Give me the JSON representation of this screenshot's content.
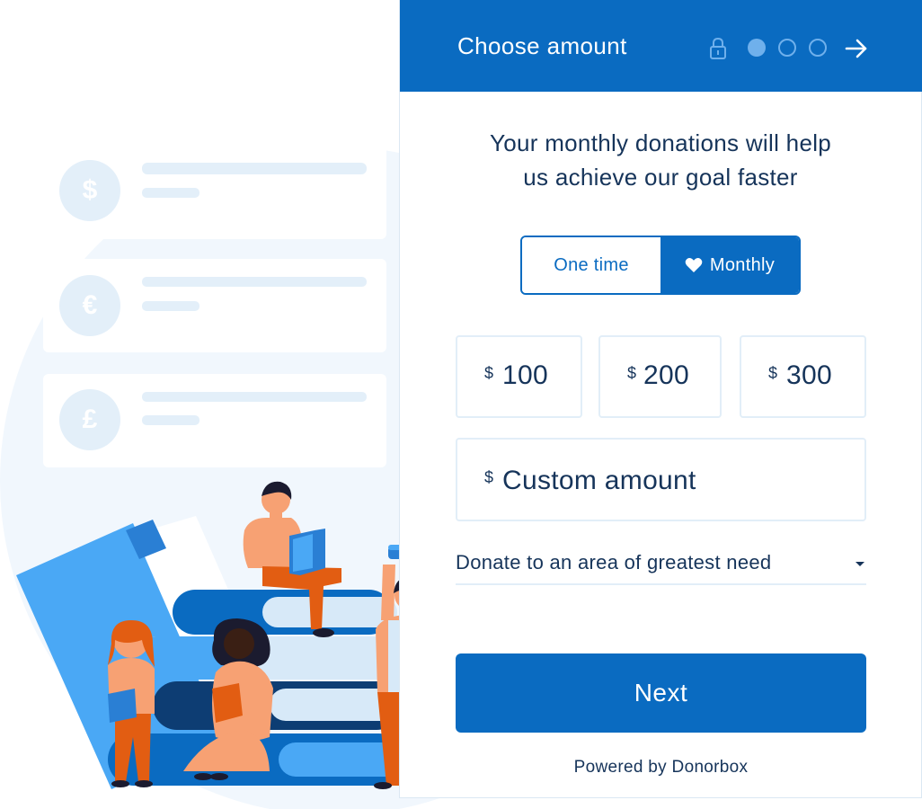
{
  "header": {
    "title": "Choose amount",
    "steps_total": 3,
    "current_step": 1,
    "icons": [
      "lock-icon",
      "step-dot",
      "arrow-right-icon"
    ]
  },
  "tagline": {
    "line1": "Your monthly donations will help",
    "line2": "us achieve our goal faster"
  },
  "frequency": {
    "one_time_label": "One time",
    "monthly_label": "Monthly",
    "selected": "Monthly"
  },
  "amounts": [
    {
      "currency": "$",
      "value": "100"
    },
    {
      "currency": "$",
      "value": "200"
    },
    {
      "currency": "$",
      "value": "300"
    }
  ],
  "custom_amount": {
    "currency": "$",
    "placeholder": "Custom amount"
  },
  "designation": {
    "selected": "Donate to an area of greatest need"
  },
  "next_button": {
    "label": "Next"
  },
  "footer": {
    "powered_by": "Powered by Donorbox"
  },
  "illustration": {
    "currency_symbols": [
      "$",
      "€",
      "£"
    ]
  },
  "colors": {
    "primary": "#0a6bc1",
    "step_dot": "#6fb0ec",
    "text": "#16345a",
    "box_border": "#e2eef8",
    "illustration_light": "#edf5fc",
    "illustration_blue": "#4aa8f5"
  }
}
